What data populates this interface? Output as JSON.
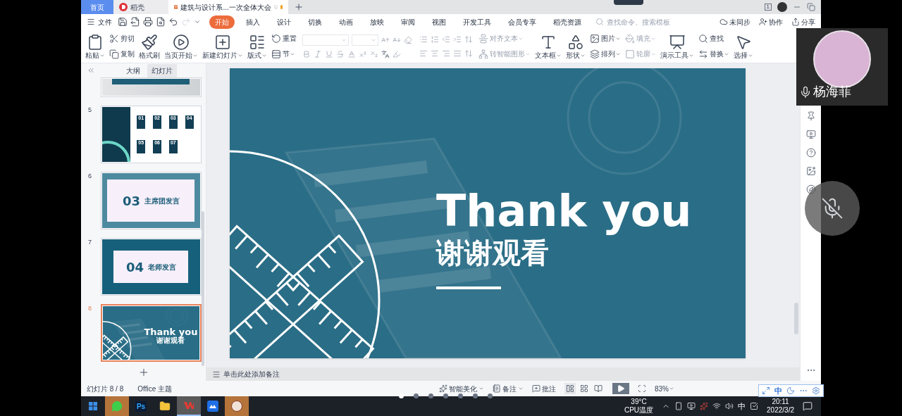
{
  "browser_tabs": [
    {
      "kind": "home",
      "label": "首页",
      "selected": false
    },
    {
      "kind": "docer",
      "label": "稻壳",
      "selected": false
    },
    {
      "kind": "document",
      "label": "建筑与设计系...一次全体大会",
      "selected": true,
      "unsaved": true
    }
  ],
  "window_badge": "1",
  "menu": {
    "file": "文件",
    "tabs": [
      {
        "label": "开始",
        "selected": true
      },
      {
        "label": "插入",
        "selected": false
      },
      {
        "label": "设计",
        "selected": false
      },
      {
        "label": "切换",
        "selected": false
      },
      {
        "label": "动画",
        "selected": false
      },
      {
        "label": "放映",
        "selected": false
      },
      {
        "label": "审阅",
        "selected": false
      },
      {
        "label": "视图",
        "selected": false
      },
      {
        "label": "开发工具",
        "selected": false
      },
      {
        "label": "会员专享",
        "selected": false
      },
      {
        "label": "稻壳资源",
        "selected": false
      }
    ],
    "search": {
      "placeholder": "查找命令、搜索模板"
    },
    "actions": [
      {
        "kind": "sync",
        "label": "未同步"
      },
      {
        "kind": "collab",
        "label": "协作"
      },
      {
        "kind": "share",
        "label": "分享"
      }
    ]
  },
  "ribbon": [
    {
      "kind": "large",
      "items": [
        {
          "kind": "paste",
          "label": "粘贴",
          "dropdown": true,
          "disabled": false
        }
      ]
    },
    {
      "kind": "stack",
      "items": [
        {
          "kind": "cut",
          "label": "剪切",
          "dropdown": false,
          "disabled": false
        },
        {
          "kind": "copy",
          "label": "复制",
          "dropdown": false,
          "disabled": false
        }
      ]
    },
    {
      "kind": "large",
      "items": [
        {
          "kind": "painter",
          "label": "格式刷",
          "dropdown": false,
          "disabled": false
        }
      ]
    },
    {
      "kind": "large",
      "items": [
        {
          "kind": "play",
          "label": "当页开始",
          "dropdown": true,
          "disabled": false
        }
      ]
    },
    {
      "kind": "large",
      "items": [
        {
          "kind": "new-slide",
          "label": "新建幻灯片",
          "dropdown": true,
          "disabled": false
        }
      ]
    },
    {
      "kind": "large",
      "items": [
        {
          "kind": "layout",
          "label": "版式",
          "dropdown": true,
          "disabled": false
        }
      ]
    },
    {
      "kind": "stack",
      "items": [
        {
          "kind": "reset",
          "label": "重置",
          "dropdown": false,
          "disabled": false
        },
        {
          "kind": "section",
          "label": "节",
          "dropdown": true,
          "disabled": false
        }
      ]
    },
    {
      "kind": "font"
    },
    {
      "kind": "paragraph"
    },
    {
      "kind": "stack",
      "items": [
        {
          "kind": "align-text",
          "label": "对齐文本",
          "dropdown": true,
          "disabled": true
        },
        {
          "kind": "smartart",
          "label": "转智能图形",
          "dropdown": true,
          "disabled": true
        }
      ]
    },
    {
      "kind": "large",
      "items": [
        {
          "kind": "textbox",
          "label": "文本框",
          "dropdown": true,
          "disabled": false
        }
      ]
    },
    {
      "kind": "large",
      "items": [
        {
          "kind": "shape",
          "label": "形状",
          "dropdown": true,
          "disabled": false
        }
      ]
    },
    {
      "kind": "stack",
      "items": [
        {
          "kind": "picture",
          "label": "图片",
          "dropdown": true,
          "disabled": false
        },
        {
          "kind": "arrange",
          "label": "排列",
          "dropdown": true,
          "disabled": false
        }
      ]
    },
    {
      "kind": "stack",
      "items": [
        {
          "kind": "fill",
          "label": "填充",
          "dropdown": true,
          "disabled": true
        },
        {
          "kind": "outline",
          "label": "轮廓",
          "dropdown": true,
          "disabled": true
        }
      ]
    },
    {
      "kind": "large",
      "items": [
        {
          "kind": "tools",
          "label": "演示工具",
          "dropdown": true,
          "disabled": false
        }
      ]
    },
    {
      "kind": "stack",
      "items": [
        {
          "kind": "find",
          "label": "查找",
          "dropdown": false,
          "disabled": false
        },
        {
          "kind": "replace",
          "label": "替换",
          "dropdown": true,
          "disabled": false
        }
      ]
    },
    {
      "kind": "large",
      "items": [
        {
          "kind": "select",
          "label": "选择",
          "dropdown": true,
          "disabled": false
        }
      ]
    }
  ],
  "panel_tabs": [
    {
      "label": "大纲",
      "selected": false
    },
    {
      "label": "幻灯片",
      "selected": true
    }
  ],
  "slides": [
    {
      "kind": "cropped",
      "selected": false
    },
    {
      "kind": "agenda",
      "number": "5",
      "items": [
        "01",
        "02",
        "03",
        "04",
        "05",
        "06",
        "07"
      ],
      "selected": false
    },
    {
      "kind": "section-light",
      "number": "6",
      "section": "03",
      "title": "主席团发言",
      "selected": false
    },
    {
      "kind": "section-dark",
      "number": "7",
      "section": "04",
      "title": "老师发言",
      "selected": false
    },
    {
      "kind": "thanks",
      "number": "8",
      "title": "Thank you",
      "subtitle": "谢谢观看",
      "selected": true
    }
  ],
  "slide": {
    "title": "Thank you",
    "subtitle": "谢谢观看"
  },
  "notes": {
    "placeholder": "单击此处添加备注"
  },
  "status": {
    "slide_info": "幻灯片 8 / 8",
    "theme": "Office 主题",
    "tools": [
      {
        "kind": "beautify",
        "label": "智能美化",
        "dropdown": true
      },
      {
        "kind": "notes",
        "label": "备注",
        "dropdown": true
      },
      {
        "kind": "comment",
        "label": "批注",
        "dropdown": false
      }
    ],
    "views": [
      {
        "kind": "normal",
        "selected": true
      },
      {
        "kind": "sorter",
        "selected": false
      },
      {
        "kind": "reading",
        "selected": false
      }
    ],
    "zoom": "83%"
  },
  "ime": {
    "mode": "中"
  },
  "page_dots": [
    {
      "selected": true
    },
    {
      "selected": false
    },
    {
      "selected": false
    },
    {
      "selected": false
    },
    {
      "selected": false
    },
    {
      "selected": false
    },
    {
      "selected": false
    }
  ],
  "taskbar": {
    "apps": [
      {
        "kind": "wechat",
        "flashing": true,
        "active": false
      },
      {
        "kind": "photoshop",
        "label": "Ps",
        "flashing": false,
        "active": false
      },
      {
        "kind": "explorer",
        "flashing": false,
        "active": false
      },
      {
        "kind": "wps",
        "flashing": false,
        "active": true
      },
      {
        "kind": "meeting",
        "flashing": false,
        "active": false
      },
      {
        "kind": "avatar-app",
        "flashing": true,
        "active": false
      }
    ],
    "temperature": "39°C",
    "temperature_label": "CPU温度",
    "tray_ime": "中",
    "time": "20:11",
    "date": "2022/3/2"
  },
  "participant": {
    "name": "杨海菲"
  }
}
